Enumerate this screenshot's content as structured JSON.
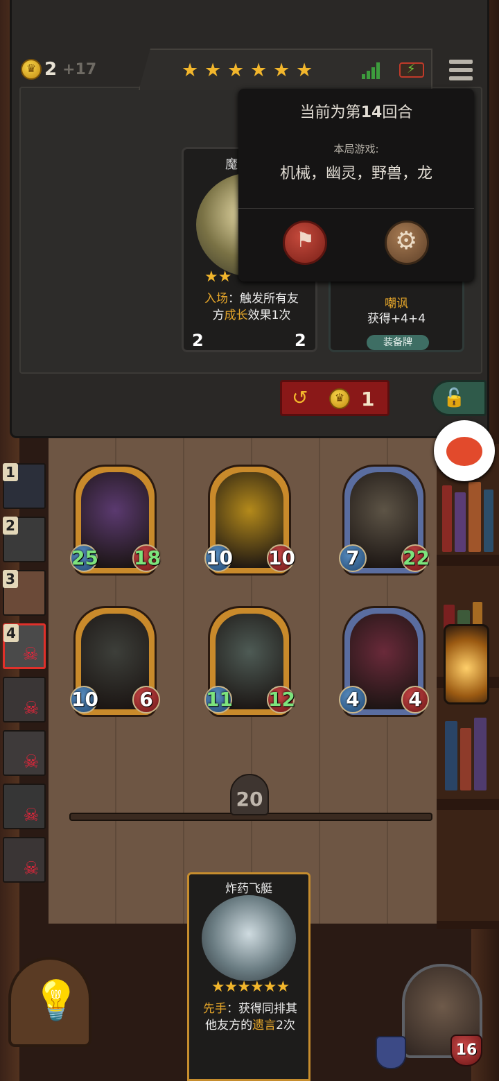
{
  "status": {
    "gold": "2",
    "gold_income": "+17",
    "tier_stars": 6,
    "signal_icon": "signal-bars-icon",
    "battery_icon": "battery-charging-icon",
    "menu_icon": "hamburger-menu-icon"
  },
  "popup": {
    "round_text_prefix": "当前为第",
    "round_number": "14",
    "round_text_suffix": "回合",
    "game_label": "本局游戏:",
    "tribes": "机械，幽灵，野兽，龙",
    "buttons": [
      "flag-surrender-icon",
      "gear-settings-icon"
    ]
  },
  "shop_cards": [
    {
      "title": "魔",
      "keyword": "入场",
      "desc_1": "：触发所有友",
      "desc_2": "方",
      "highlight": "成长",
      "desc_3": "效果1次",
      "attack": "2",
      "health": "2",
      "stars": 2
    },
    {
      "title": "嘲讽",
      "desc": "获得+4+4",
      "tag": "装备牌"
    }
  ],
  "refresh": {
    "cost": "1"
  },
  "board": {
    "timer": "20",
    "minions": [
      {
        "attack": "25",
        "health": "18",
        "attack_green": true,
        "health_green": true,
        "frame": "#c98a2b",
        "bg": "#5b3a70"
      },
      {
        "attack": "10",
        "health": "10",
        "attack_green": false,
        "health_green": false,
        "frame": "#c98a2b",
        "bg": "#b48a1b"
      },
      {
        "attack": "7",
        "health": "22",
        "attack_green": false,
        "health_green": true,
        "frame": "#5a6da0",
        "bg": "#5d5446"
      },
      {
        "attack": "10",
        "health": "6",
        "attack_green": false,
        "health_green": false,
        "frame": "#c98a2b",
        "bg": "#3d3f3a"
      },
      {
        "attack": "11",
        "health": "12",
        "attack_green": true,
        "health_green": true,
        "frame": "#c98a2b",
        "bg": "#4e5b55"
      },
      {
        "attack": "4",
        "health": "4",
        "attack_green": false,
        "health_green": false,
        "frame": "#5a6da0",
        "bg": "#6a2a3a"
      }
    ]
  },
  "sidebar": [
    {
      "rank": "1",
      "dead": false
    },
    {
      "rank": "2",
      "dead": false
    },
    {
      "rank": "3",
      "dead": false
    },
    {
      "rank": "4",
      "dead": true
    },
    {
      "rank": "",
      "dead": true
    },
    {
      "rank": "",
      "dead": true
    },
    {
      "rank": "",
      "dead": true
    },
    {
      "rank": "",
      "dead": true
    }
  ],
  "hand_card": {
    "title": "炸药飞艇",
    "stars": 6,
    "keyword": "先手",
    "desc_1": "：获得同排其",
    "desc_2": "他友方的",
    "highlight": "遗言",
    "desc_3": "2次"
  },
  "hero": {
    "health": "16"
  }
}
